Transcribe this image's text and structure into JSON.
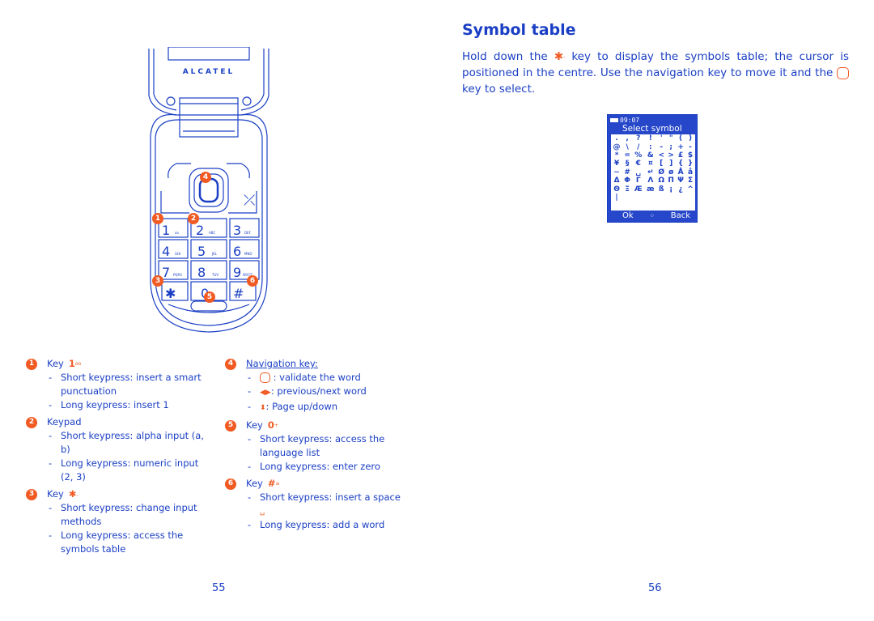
{
  "left_page": {
    "phone": {
      "brand": "ALCATEL",
      "keys": [
        {
          "digit": "1",
          "letters": "oo"
        },
        {
          "digit": "2",
          "letters": "ABC"
        },
        {
          "digit": "3",
          "letters": "DEF"
        },
        {
          "digit": "4",
          "letters": "GHI"
        },
        {
          "digit": "5",
          "letters": "JKL"
        },
        {
          "digit": "6",
          "letters": "MNO"
        },
        {
          "digit": "7",
          "letters": "PQRS"
        },
        {
          "digit": "8",
          "letters": "TUV"
        },
        {
          "digit": "9",
          "letters": "WXYZ"
        },
        {
          "digit": "*",
          "letters": ","
        },
        {
          "digit": "0",
          "letters": "+"
        },
        {
          "digit": "#",
          "letters": "≡"
        }
      ],
      "callouts": [
        "1",
        "2",
        "3",
        "4",
        "5",
        "6"
      ]
    },
    "items": [
      {
        "number": "1",
        "label": "Key",
        "key_glyph": "1",
        "key_sub": "oo",
        "bullets": [
          "Short keypress: insert a smart punctuation",
          "Long keypress: insert 1"
        ]
      },
      {
        "number": "2",
        "label": "Keypad",
        "bullets": [
          "Short keypress: alpha input (a, b)",
          "Long keypress: numeric input (2, 3)"
        ]
      },
      {
        "number": "3",
        "label": "Key",
        "key_glyph": "✱",
        "key_sub": ",",
        "bullets": [
          "Short keypress: change input methods",
          "Long keypress: access the symbols table"
        ]
      },
      {
        "number": "4",
        "label": "Navigation key:",
        "bullets": [
          ": validate the word",
          ": previous/next word",
          ": Page up/down"
        ],
        "bullet_icons": [
          "ok-ring-icon",
          "left-right-arrows-icon",
          "up-down-arrows-icon"
        ]
      },
      {
        "number": "5",
        "label": "Key",
        "key_glyph": "0",
        "key_sub": "+",
        "bullets": [
          "Short keypress: access the language list",
          "Long keypress: enter zero"
        ]
      },
      {
        "number": "6",
        "label": "Key",
        "key_glyph": "#",
        "key_sub": "≡",
        "bullets": [
          "Short keypress: insert a space",
          "Long keypress: add a word"
        ],
        "space_glyph": "␣"
      }
    ],
    "page_number": "55"
  },
  "right_page": {
    "title": "Symbol table",
    "paragraph": {
      "part1": "Hold down the",
      "key_glyph": "✱",
      "key_sub": ",",
      "part2": "key to display the symbols table; the cursor is positioned in the centre. Use the navigation key to move it and the",
      "part3": "key to select."
    },
    "screen": {
      "time": "09:07",
      "title": "Select symbol",
      "rows": [
        [
          ".",
          ",",
          "?",
          "!",
          "'",
          "\"",
          "(",
          ")"
        ],
        [
          "@",
          "\\",
          "/",
          ":",
          "-",
          ";",
          "+",
          "-"
        ],
        [
          "*",
          "=",
          "%",
          "&",
          "<",
          ">",
          "£",
          "$"
        ],
        [
          "¥",
          "§",
          "€",
          "¤",
          "[",
          "]",
          "{",
          "}"
        ],
        [
          "~",
          "#",
          "␣",
          "↵",
          "Ø",
          "ø",
          "Å",
          "å"
        ],
        [
          "Δ",
          "Φ",
          "Γ",
          "Λ",
          "Ω",
          "Π",
          "Ψ",
          "Σ"
        ],
        [
          "Θ",
          "Ξ",
          "Æ",
          "æ",
          "ß",
          "¡",
          "¿",
          "^"
        ],
        [
          "|",
          "",
          "",
          "",
          "",
          "",
          "",
          ""
        ]
      ],
      "softkey_left": "Ok",
      "softkey_right": "Back",
      "nav_icon": "⁘"
    },
    "page_number": "56"
  },
  "colors": {
    "text_blue": "#1a3fc4",
    "accent_orange": "#f15a22",
    "screen_blue": "#2647c9"
  }
}
